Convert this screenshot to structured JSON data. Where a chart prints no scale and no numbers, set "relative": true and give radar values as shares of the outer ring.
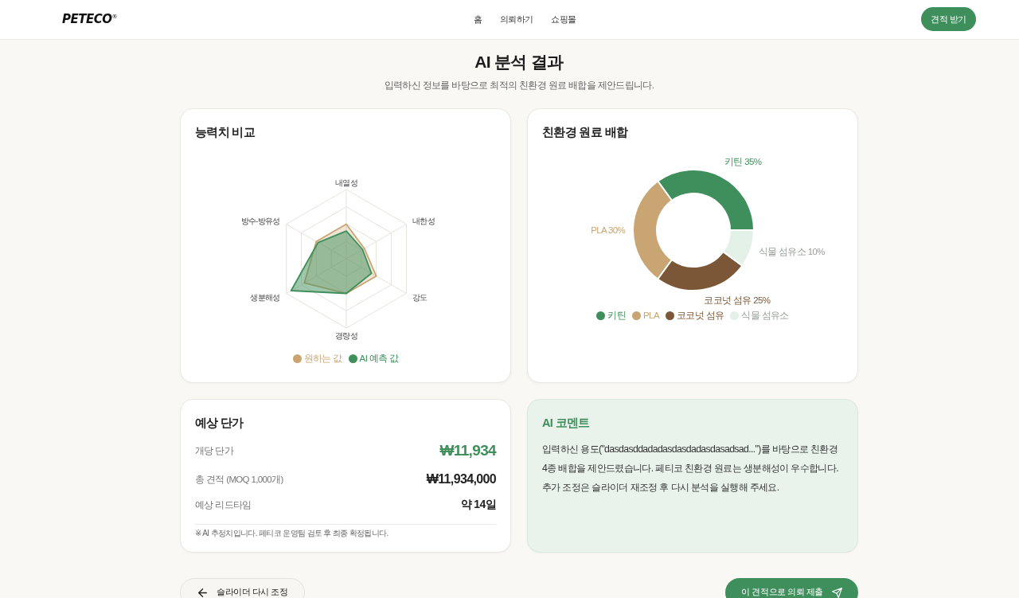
{
  "header": {
    "logo": "PETECO$^{®}$",
    "nav": [
      {
        "label": "홈"
      },
      {
        "label": "의뢰하기"
      },
      {
        "label": "쇼핑몰"
      }
    ],
    "cta": "견적 받기"
  },
  "intro": {
    "title": "AI 분석 결과",
    "subtitle": "입력하신 정보를 바탕으로 최적의 친환경 원료 배합을 제안드립니다."
  },
  "ability_card": {
    "title": "능력치 비교",
    "chart_data": {
      "type": "radar",
      "relative": true,
      "legend": "bottom",
      "categories": [
        "내열성",
        "내한성",
        "강도",
        "경량성",
        "생분해성",
        "방수-방유성"
      ],
      "series": [
        {
          "name": "원하는 값",
          "color": "#c9a574",
          "values": [
            0.5,
            0.3,
            0.5,
            0.5,
            0.7,
            0.5
          ]
        },
        {
          "name": "AI 예측 값",
          "color": "#3f8f5c",
          "values": [
            0.4,
            0.27,
            0.42,
            0.5,
            0.92,
            0.47
          ]
        }
      ]
    }
  },
  "blend_card": {
    "title": "친환경 원료 배합",
    "chart_data": {
      "type": "donut",
      "legend": "bottom",
      "categories": [
        "키틴",
        "PLA",
        "코코넛 섬유",
        "식물 섬유소"
      ],
      "values": [
        35,
        30,
        25,
        10
      ],
      "colors": [
        "#3f8f5c",
        "#c9a574",
        "#7b5737",
        "#e4f1e8"
      ],
      "value_labels": [
        "키틴 35%",
        "PLA 30%",
        "코코넛 섬유 25%",
        "식물 섬유소 10%"
      ]
    }
  },
  "price_card": {
    "title": "예상 단가",
    "rows": [
      {
        "kind": "highlight",
        "label": "개당 단가",
        "value": "₩11,934"
      },
      {
        "kind": "total",
        "label": "총 견적 (MOQ 1,000개)",
        "value": "₩11,934,000"
      },
      {
        "kind": "plain",
        "label": "예상 리드타임",
        "value": "약 14일"
      }
    ],
    "note": "※ AI 추정치입니다. 페티코 운영팀 검토 후 최종 확정됩니다."
  },
  "comment_card": {
    "title": "AI 코멘트",
    "text": "입력하신 용도(\"dasdasddadadasdasdadasdasadsad...\")를 바탕으로 친환경 4종 배합을 제안드렸습니다. 페티코 친환경 원료는 생분해성이 우수합니다. 추가 조정은 슬라이더 재조정 후 다시 분석을 실행해 주세요."
  },
  "actions": [
    {
      "kind": "back",
      "label": "슬라이더 다시 조정"
    },
    {
      "kind": "submit",
      "label": "이 견적으로 의뢰 제출"
    }
  ]
}
